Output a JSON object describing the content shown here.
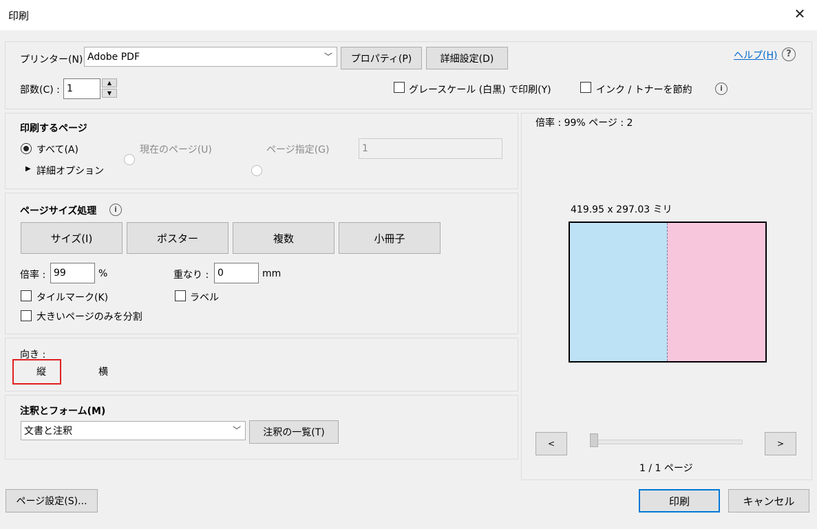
{
  "window": {
    "title": "印刷",
    "close_glyph": "✕"
  },
  "printer": {
    "label": "プリンター(N) :",
    "selected": "Adobe PDF",
    "properties_button": "プロパティ(P)",
    "advanced_button": "詳細設定(D)",
    "help_link": "ヘルプ(H)",
    "copies_label": "部数(C) :",
    "copies_value": "1",
    "grayscale_label": "グレースケール (白黒) で印刷(Y)",
    "save_ink_label": "インク / トナーを節約"
  },
  "pages": {
    "heading": "印刷するページ",
    "all_label": "すべて(A)",
    "current_label": "現在のページ(U)",
    "range_label": "ページ指定(G)",
    "range_value": "1",
    "more_options": "詳細オプション"
  },
  "page_size": {
    "heading": "ページサイズ処理",
    "tabs": [
      "サイズ(I)",
      "ポスター",
      "複数",
      "小冊子"
    ],
    "scale_label": "倍率 :",
    "scale_value": "99",
    "scale_unit": "%",
    "overlap_label": "重なり :",
    "overlap_value": "0",
    "overlap_unit": "mm",
    "tile_marks_label": "タイルマーク(K)",
    "labels_label": "ラベル",
    "large_pages_label": "大きいページのみを分割"
  },
  "orientation": {
    "label": "向き :",
    "portrait": "縦",
    "landscape": "横",
    "highlight_color": "#e02020"
  },
  "annotations": {
    "heading": "注釈とフォーム(M)",
    "selected": "文書と注釈",
    "summary_button": "注釈の一覧(T)"
  },
  "preview": {
    "scale_info": "倍率 : 99% ページ : 2",
    "dimensions": "419.95 x 297.03 ミリ",
    "left_color": "#bde1f5",
    "right_color": "#f7c6dd",
    "prev_button": "<",
    "next_button": ">",
    "page_indicator": "1 / 1 ページ"
  },
  "footer": {
    "page_setup_button": "ページ設定(S)...",
    "print_button": "印刷",
    "cancel_button": "キャンセル"
  }
}
